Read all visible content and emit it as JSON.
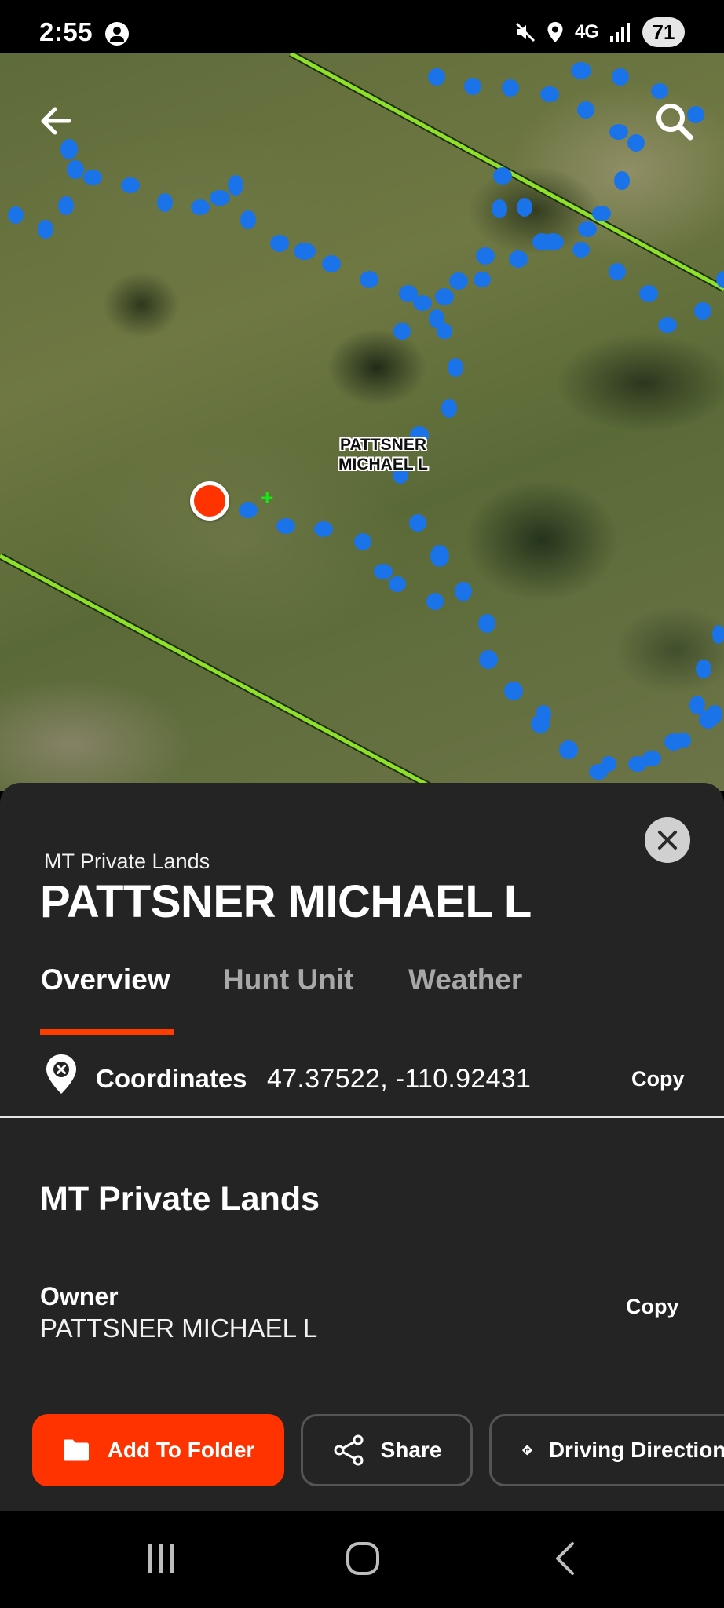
{
  "status_bar": {
    "time": "2:55",
    "network": "4G",
    "battery": "71",
    "icons": [
      "account-icon",
      "mute-icon",
      "location-icon",
      "signal-icon"
    ]
  },
  "map": {
    "parcel_label_line1": "PATTSNER",
    "parcel_label_line2": "MICHAEL L",
    "icons": [
      "back-arrow-icon",
      "search-icon"
    ],
    "colors": {
      "boundary": "#8ee02a",
      "trail": "#1a73e8",
      "pin": "#ff3300"
    }
  },
  "sheet": {
    "category": "MT Private Lands",
    "title": "PATTSNER MICHAEL L",
    "tabs": [
      {
        "label": "Overview",
        "active": true
      },
      {
        "label": "Hunt Unit",
        "active": false
      },
      {
        "label": "Weather",
        "active": false
      }
    ],
    "coordinates": {
      "label": "Coordinates",
      "value": "47.37522, -110.92431",
      "copy_label": "Copy"
    },
    "section_title": "MT Private Lands",
    "owner": {
      "label": "Owner",
      "value": "PATTSNER MICHAEL L",
      "copy_label": "Copy"
    },
    "actions": {
      "add_to_folder": "Add To Folder",
      "share": "Share",
      "driving_directions": "Driving Directions"
    },
    "accent_color": "#ff3300"
  }
}
